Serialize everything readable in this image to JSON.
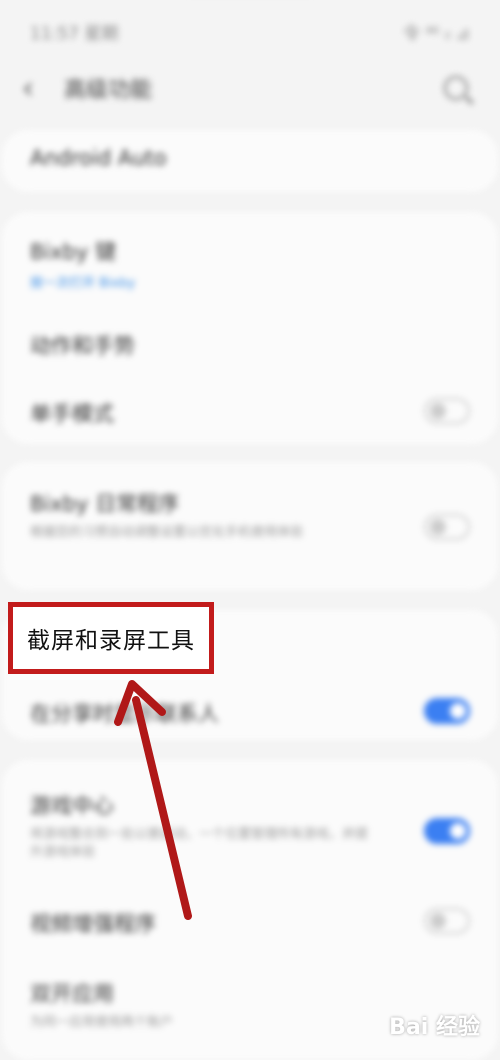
{
  "status_bar": {
    "time": "11:57 星期",
    "icons": "令 ⁴⁶ ᵢₗ ⊿"
  },
  "header": {
    "back_icon": "back-arrow-icon",
    "title": "高级功能",
    "search_icon": "search-icon"
  },
  "sections": {
    "android_auto": "Android Auto",
    "bixby_key": {
      "title": "Bixby 键",
      "subtitle": "按一次打开 Bixby"
    },
    "smart_suggestions": "动作和手势",
    "one_hand_mode": {
      "title": "单手模式",
      "toggle_on": false
    },
    "bixby_routines": {
      "title": "Bixby 日常程序",
      "subtitle": "根据您的习惯自动调整设置以优化手机使用体验",
      "toggle_on": false
    },
    "screenshot_recorder": "截屏和录屏工具",
    "show_contacts": {
      "title": "在分享时显示联系人",
      "toggle_on": true
    },
    "game_launcher": {
      "title": "游戏中心",
      "subtitle": "将游戏整合到一处以便启动，一个位置管理所有游戏，并提升游戏体验",
      "toggle_on": true
    },
    "video_enhancer": {
      "title": "视频增强程序",
      "toggle_on": false
    },
    "dual_messenger": {
      "title": "双开应用",
      "subtitle": "为同一应用使用两个账户"
    }
  },
  "annotation": {
    "highlight_label": "截屏和录屏工具",
    "arrow_color": "#c21b1b"
  },
  "watermark": "Bai 经验"
}
